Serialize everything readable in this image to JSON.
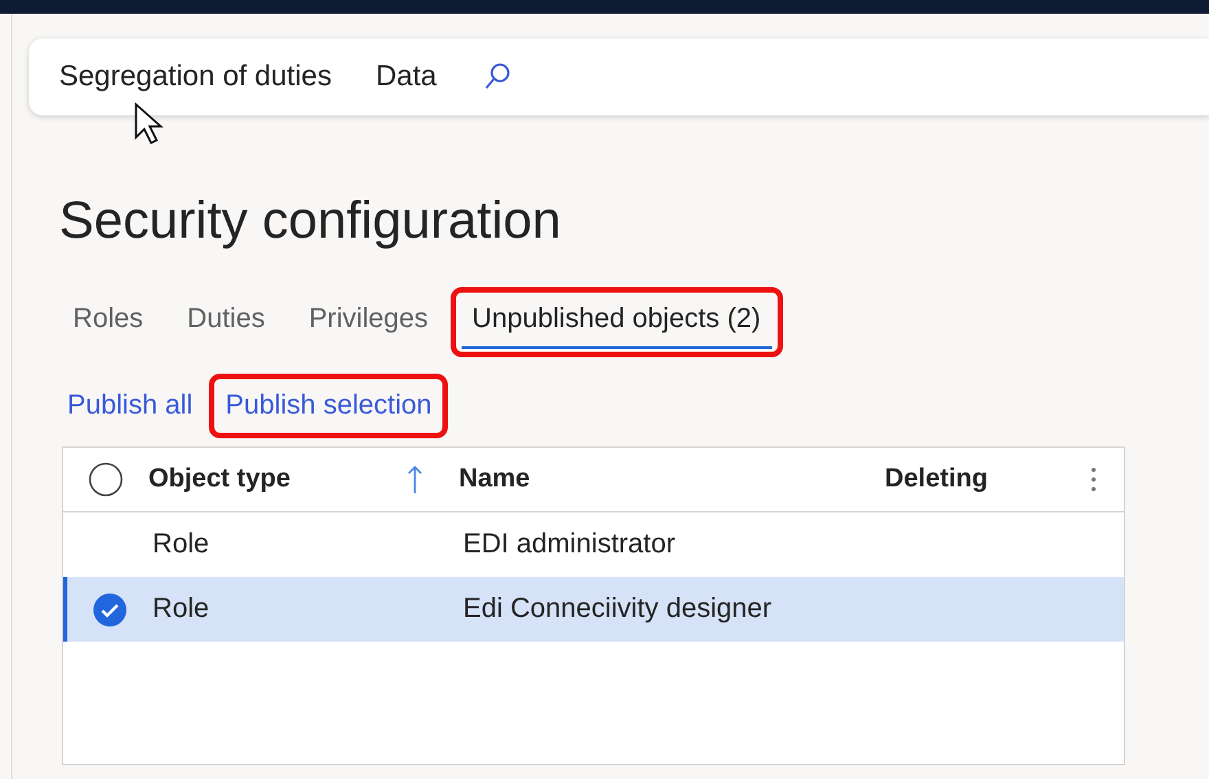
{
  "toolbar": {
    "items": [
      "Segregation of duties",
      "Data"
    ]
  },
  "title": "Security configuration",
  "tabs": [
    {
      "label": "Roles",
      "selected": false,
      "highlighted": false
    },
    {
      "label": "Duties",
      "selected": false,
      "highlighted": false
    },
    {
      "label": "Privileges",
      "selected": false,
      "highlighted": false
    },
    {
      "label": "Unpublished objects (2)",
      "selected": true,
      "highlighted": true
    }
  ],
  "actions": [
    {
      "label": "Publish all",
      "highlighted": false
    },
    {
      "label": "Publish selection",
      "highlighted": true
    }
  ],
  "table": {
    "all_selected": false,
    "columns": [
      "Object type",
      "Name",
      "Deleting"
    ],
    "rows": [
      {
        "cells": [
          "Role",
          "EDI administrator",
          ""
        ],
        "selected": false
      },
      {
        "cells": [
          "Role",
          "Edi Conneciivity designer",
          ""
        ],
        "selected": true
      }
    ]
  }
}
